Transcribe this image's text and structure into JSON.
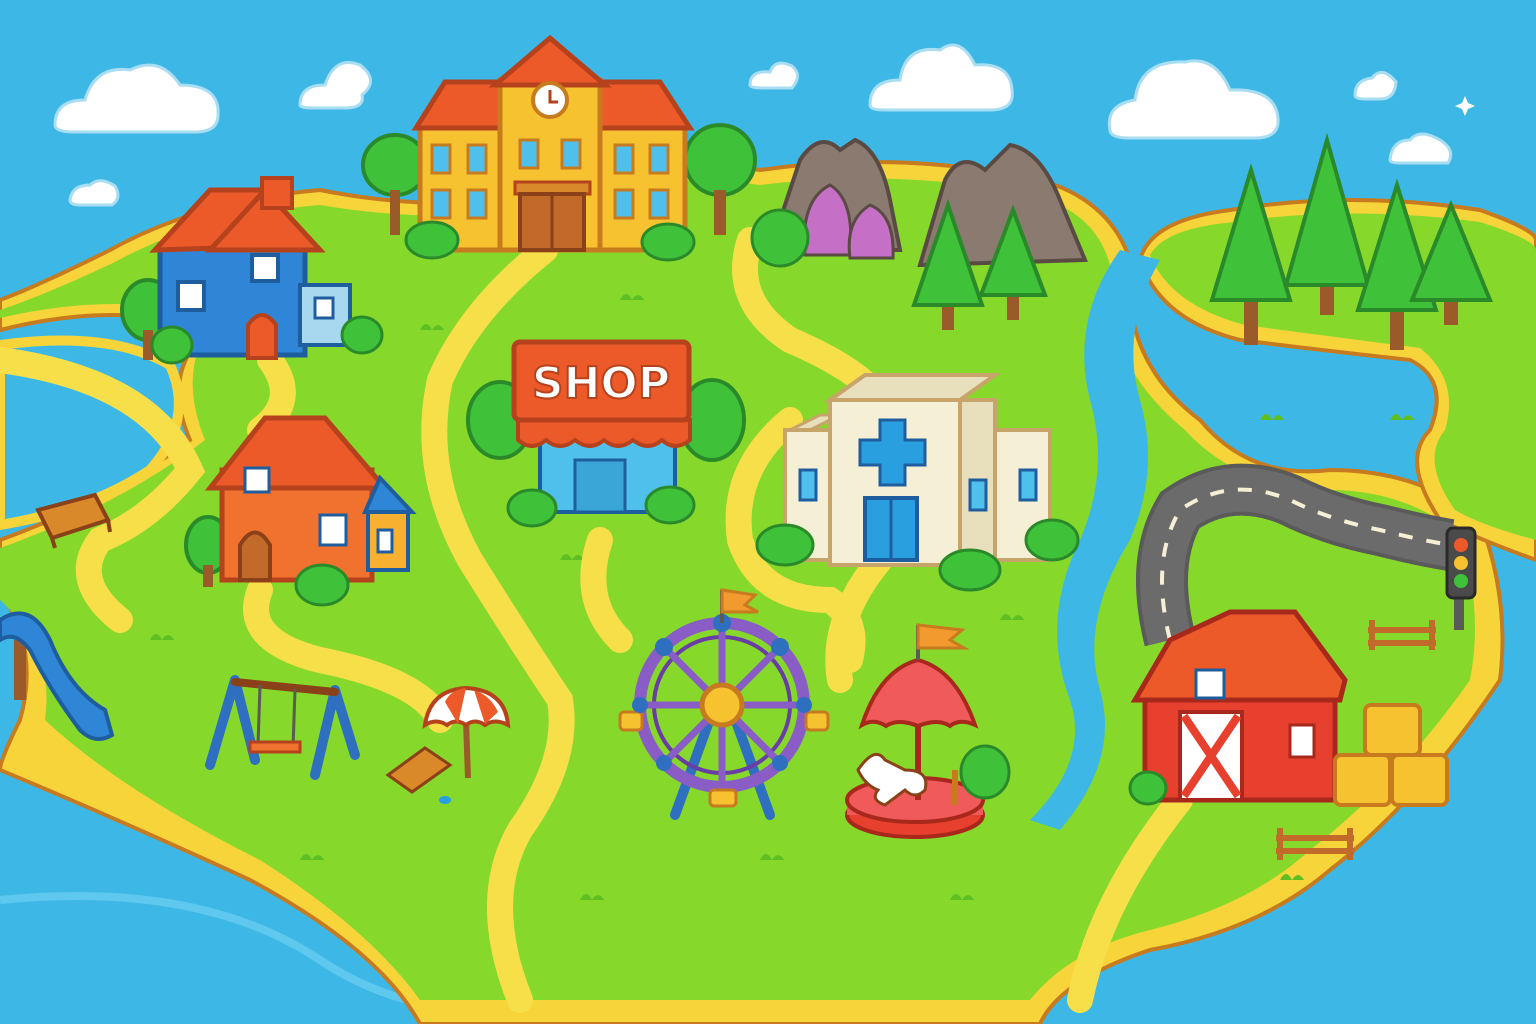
{
  "scene": {
    "shop_sign": "SHOP"
  },
  "colors": {
    "water": "#3db8e6",
    "water_dark": "#2a9fd6",
    "grass": "#86d82a",
    "grass_dark": "#6cc01e",
    "sand": "#f6d43a",
    "path": "#f7df4a",
    "outline": "#c77a1e",
    "tree": "#3fc23a",
    "tree_dark": "#2a9a2e",
    "trunk": "#9a5a2a",
    "roof_red": "#ec5a2a",
    "house_blue": "#2f86d6",
    "house_orange": "#f0722e",
    "school": "#f7c230",
    "hospital": "#f5efd6",
    "hospital_cross": "#2a9fe0",
    "barn": "#e8402e",
    "ferris": "#8a5cc6",
    "carousel": "#f05a5a",
    "road": "#6b6b6b"
  },
  "icons": {
    "school": "school-building-icon",
    "clock": "clock-icon",
    "shop": "shop-icon",
    "hospital": "hospital-icon",
    "barn": "barn-icon",
    "ferris_wheel": "ferris-wheel-icon",
    "carousel": "carousel-icon",
    "traffic_light": "traffic-light-icon",
    "slide": "slide-icon",
    "swing": "swing-icon",
    "umbrella": "beach-umbrella-icon"
  }
}
